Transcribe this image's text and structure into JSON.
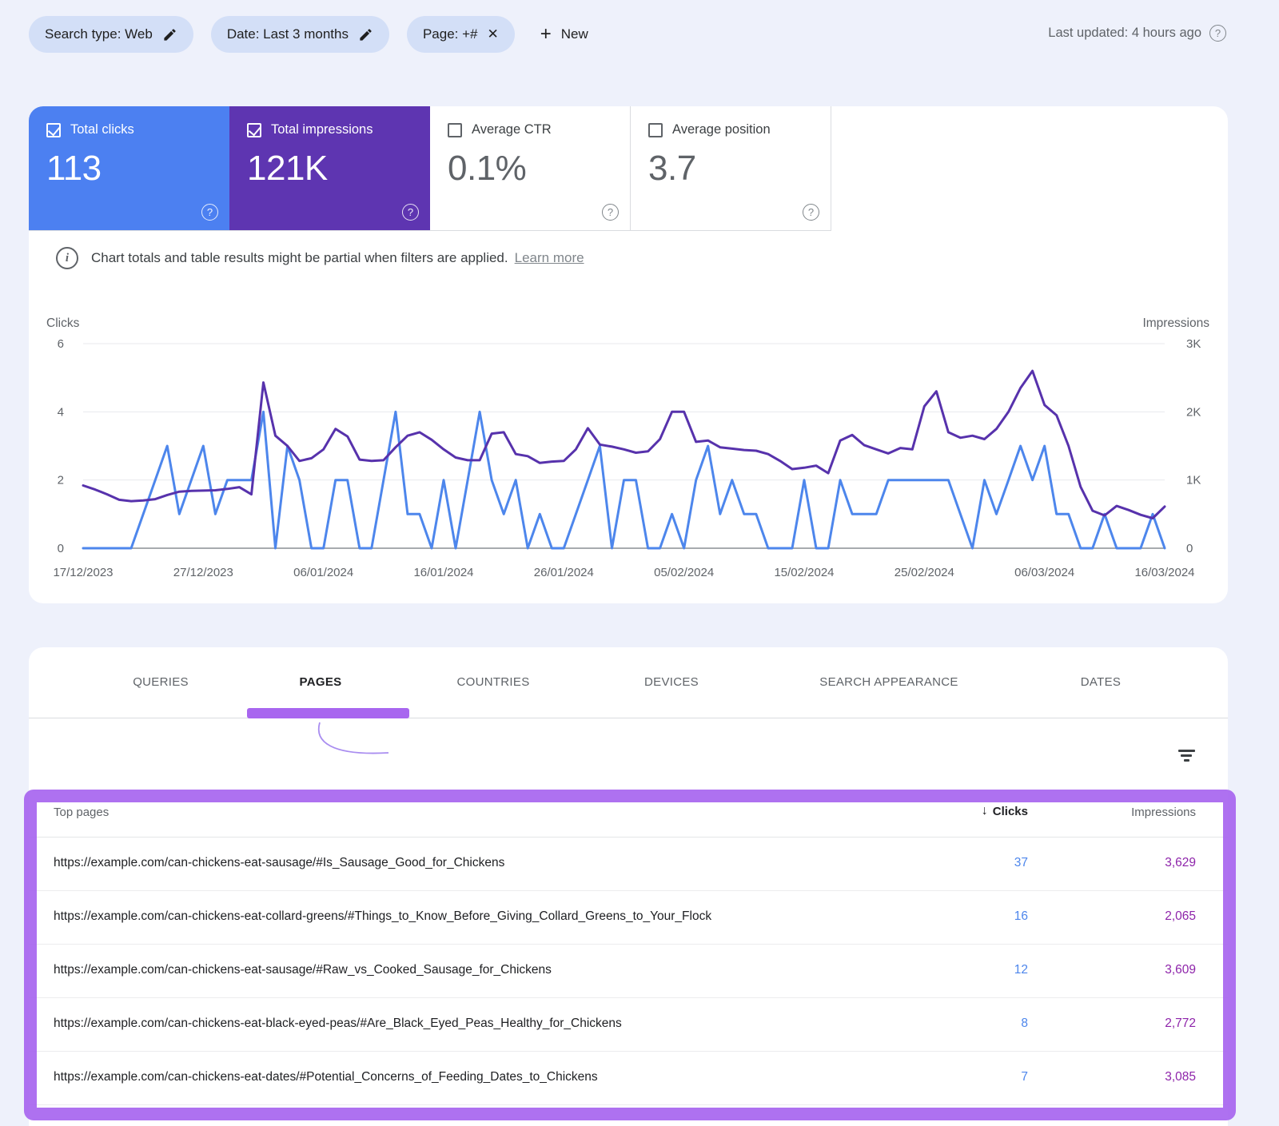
{
  "filter_bar": {
    "chips": [
      {
        "label": "Search type: Web",
        "action": "edit"
      },
      {
        "label": "Date: Last 3 months",
        "action": "edit"
      },
      {
        "label": "Page: +#",
        "action": "remove"
      }
    ],
    "new_button": "New",
    "last_updated": "Last updated: 4 hours ago"
  },
  "metrics": [
    {
      "label": "Total clicks",
      "value": "113",
      "checked": true,
      "bg": "#4c80f1"
    },
    {
      "label": "Total impressions",
      "value": "121K",
      "checked": true,
      "bg": "#5e35b1"
    },
    {
      "label": "Average CTR",
      "value": "0.1%",
      "checked": false,
      "bg": "#ffffff"
    },
    {
      "label": "Average position",
      "value": "3.7",
      "checked": false,
      "bg": "#ffffff"
    }
  ],
  "notice": {
    "text": "Chart totals and table results might be partial when filters are applied.",
    "link": "Learn more"
  },
  "chart_data": {
    "type": "line",
    "x_start": "17/12/2023",
    "x_end": "16/03/2024",
    "x_tick_labels": [
      "17/12/2023",
      "27/12/2023",
      "06/01/2024",
      "16/01/2024",
      "26/01/2024",
      "05/02/2024",
      "15/02/2024",
      "25/02/2024",
      "06/03/2024",
      "16/03/2024"
    ],
    "x_tick_day_index": [
      0,
      10,
      20,
      30,
      40,
      50,
      60,
      70,
      80,
      90
    ],
    "left_axis": {
      "label": "Clicks",
      "ticks": [
        "6",
        "4",
        "2",
        "0"
      ],
      "tick_values": [
        6,
        4,
        2,
        0
      ],
      "max": 6
    },
    "right_axis": {
      "label": "Impressions",
      "ticks": [
        "3K",
        "2K",
        "1K",
        "0"
      ],
      "tick_values": [
        3000,
        2000,
        1000,
        0
      ],
      "max": 3000
    },
    "grid": true,
    "legend_position": "none",
    "series": [
      {
        "name": "Clicks",
        "axis": "left",
        "color": "#4d86ec",
        "values": [
          0,
          0,
          0,
          0,
          0,
          1,
          2,
          3,
          1,
          2,
          3,
          1,
          2,
          2,
          2,
          4,
          0,
          3,
          2,
          0,
          0,
          2,
          2,
          0,
          0,
          2,
          4,
          1,
          1,
          0,
          2,
          0,
          2,
          4,
          2,
          1,
          2,
          0,
          1,
          0,
          0,
          1,
          2,
          3,
          0,
          2,
          2,
          0,
          0,
          1,
          0,
          2,
          3,
          1,
          2,
          1,
          1,
          0,
          0,
          0,
          2,
          0,
          0,
          2,
          1,
          1,
          1,
          2,
          2,
          2,
          2,
          2,
          2,
          1,
          0,
          2,
          1,
          2,
          3,
          2,
          3,
          1,
          1,
          0,
          0,
          1,
          0,
          0,
          0,
          1,
          0
        ]
      },
      {
        "name": "Impressions",
        "axis": "right",
        "color": "#5732ac",
        "values": [
          920,
          860,
          790,
          710,
          690,
          700,
          720,
          780,
          830,
          840,
          845,
          850,
          870,
          895,
          790,
          2430,
          1650,
          1500,
          1280,
          1320,
          1450,
          1750,
          1640,
          1300,
          1280,
          1290,
          1480,
          1650,
          1700,
          1590,
          1450,
          1330,
          1290,
          1290,
          1680,
          1700,
          1380,
          1350,
          1250,
          1270,
          1280,
          1450,
          1760,
          1520,
          1490,
          1450,
          1400,
          1420,
          1600,
          2000,
          2000,
          1560,
          1580,
          1480,
          1460,
          1440,
          1430,
          1380,
          1280,
          1160,
          1180,
          1210,
          1100,
          1580,
          1660,
          1510,
          1450,
          1390,
          1470,
          1450,
          2080,
          2300,
          1700,
          1620,
          1650,
          1600,
          1750,
          2000,
          2350,
          2600,
          2100,
          1950,
          1500,
          900,
          550,
          480,
          620,
          560,
          490,
          440,
          610
        ]
      }
    ]
  },
  "tabs": {
    "items": [
      "QUERIES",
      "PAGES",
      "COUNTRIES",
      "DEVICES",
      "SEARCH APPEARANCE",
      "DATES"
    ],
    "active": "PAGES"
  },
  "table": {
    "columns": [
      "Top pages",
      "Clicks",
      "Impressions"
    ],
    "sort_column": "Clicks",
    "sort_direction": "desc",
    "rows": [
      {
        "page": "https://example.com/can-chickens-eat-sausage/#Is_Sausage_Good_for_Chickens",
        "clicks": "37",
        "impressions": "3,629"
      },
      {
        "page": "https://example.com/can-chickens-eat-collard-greens/#Things_to_Know_Before_Giving_Collard_Greens_to_Your_Flock",
        "clicks": "16",
        "impressions": "2,065"
      },
      {
        "page": "https://example.com/can-chickens-eat-sausage/#Raw_vs_Cooked_Sausage_for_Chickens",
        "clicks": "12",
        "impressions": "3,609"
      },
      {
        "page": "https://example.com/can-chickens-eat-black-eyed-peas/#Are_Black_Eyed_Peas_Healthy_for_Chickens",
        "clicks": "8",
        "impressions": "2,772"
      },
      {
        "page": "https://example.com/can-chickens-eat-dates/#Potential_Concerns_of_Feeding_Dates_to_Chickens",
        "clicks": "7",
        "impressions": "3,085"
      }
    ]
  },
  "colors": {
    "page_bg": "#eef1fb",
    "chip_bg": "#d3dff7",
    "clicks_blue": "#4d86ec",
    "impressions_purple": "#5732ac",
    "card_clicks_bg": "#4c80f1",
    "card_impressions_bg": "#5e35b1",
    "table_clicks_value": "#4d86ec",
    "table_impressions_value": "#8e24aa",
    "highlight_purple": "#a866ef",
    "gridline": "#e8eaed",
    "axis_line": "#8a8f94"
  }
}
